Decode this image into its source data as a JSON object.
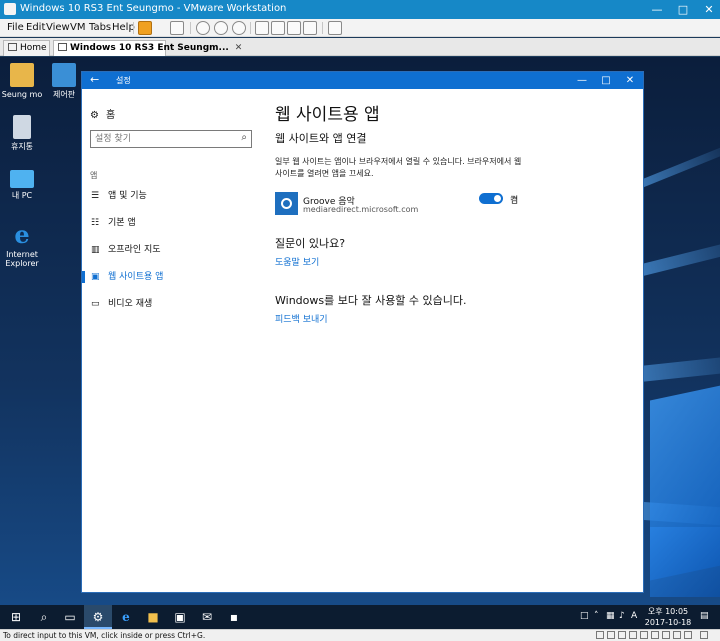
{
  "vm": {
    "title": "Windows 10 RS3 Ent Seungmo - VMware Workstation",
    "menu": [
      "File",
      "Edit",
      "View",
      "VM",
      "Tabs",
      "Help"
    ],
    "tabs": [
      {
        "label": "Home"
      },
      {
        "label": "Windows 10 RS3 Ent Seungm..."
      }
    ],
    "status_message": "To direct input to this VM, click inside or press Ctrl+G."
  },
  "desktop": {
    "icons": [
      {
        "label": "Seung mo",
        "icon": "user-folder-icon",
        "color": "#e8b64a"
      },
      {
        "label": "제어판",
        "icon": "control-panel-icon",
        "color": "#3a8fd6"
      },
      {
        "label": "휴지통",
        "icon": "recycle-bin-icon",
        "color": "#cfd8e3"
      },
      {
        "label": "내 PC",
        "icon": "this-pc-icon",
        "color": "#4fb2f0"
      },
      {
        "label": "Internet Explorer",
        "icon": "internet-explorer-icon",
        "color": "#2a8fe0"
      }
    ]
  },
  "settings": {
    "app_title": "설정",
    "home_label": "홈",
    "search_placeholder": "설정 찾기",
    "section_label": "앱",
    "nav_items": [
      {
        "label": "앱 및 기능",
        "icon": "apps-features-icon"
      },
      {
        "label": "기본 앱",
        "icon": "default-apps-icon"
      },
      {
        "label": "오프라인 지도",
        "icon": "offline-maps-icon"
      },
      {
        "label": "웹 사이트용 앱",
        "icon": "apps-for-websites-icon",
        "active": true
      },
      {
        "label": "비디오 재생",
        "icon": "video-playback-icon"
      }
    ],
    "page_title": "웹 사이트용 앱",
    "subheading": "웹 사이트와 앱 연결",
    "description": "일부 웹 사이트는 앱이나 브라우저에서 열릴 수 있습니다. 브라우저에서 웹 사이트를 열려면 앱을 끄세요.",
    "app": {
      "name": "Groove 음악",
      "domain": "mediaredirect.microsoft.com",
      "toggle_label": "켬",
      "toggle_on": true
    },
    "question_heading": "질문이 있나요?",
    "help_link": "도움말 보기",
    "better_heading": "Windows를 보다 잘 사용할 수 있습니다.",
    "feedback_link": "피드백 보내기",
    "accent": "#0f6fd1"
  },
  "taskbar": {
    "time": "오후 10:05",
    "date": "2017-10-18"
  }
}
